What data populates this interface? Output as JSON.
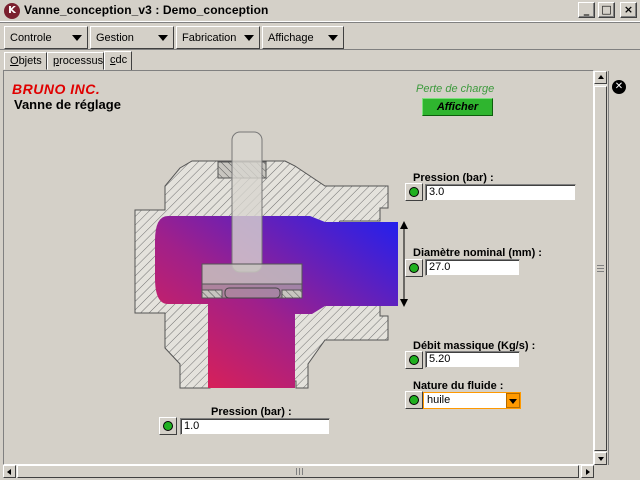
{
  "window": {
    "title": "Vanne_conception_v3 : Demo_conception",
    "icon_letter": "K"
  },
  "menus": [
    {
      "label": "Controle"
    },
    {
      "label": "Gestion"
    },
    {
      "label": "Fabrication"
    },
    {
      "label": "Affichage"
    }
  ],
  "tabs": [
    {
      "label": "Objets",
      "underline": "O",
      "rest": "bjets"
    },
    {
      "label": "processus",
      "underline": "p",
      "rest": "rocessus"
    },
    {
      "label": "cdc",
      "underline": "c",
      "rest": "dc",
      "active": true
    }
  ],
  "content": {
    "company": "BRUNO INC.",
    "subtitle": "Vanne de réglage",
    "perte_label": "Perte de charge",
    "afficher": "Afficher"
  },
  "fields": {
    "pression_out": {
      "label": "Pression (bar) :",
      "value": "3.0"
    },
    "diametre": {
      "label": "Diamètre nominal (mm) :",
      "value": "27.0"
    },
    "debit": {
      "label": "Débit massique (Kg/s) :",
      "value": "5.20"
    },
    "fluide": {
      "label": "Nature du fluide :",
      "value": "huile"
    },
    "pression_in": {
      "label": "Pression (bar) :",
      "value": "1.0"
    }
  },
  "colors": {
    "status_green": "#20b020",
    "accent_orange": "#ff9900",
    "brand_red": "#e00000",
    "flow_red": "#e0204a",
    "flow_blue": "#2020f0"
  }
}
